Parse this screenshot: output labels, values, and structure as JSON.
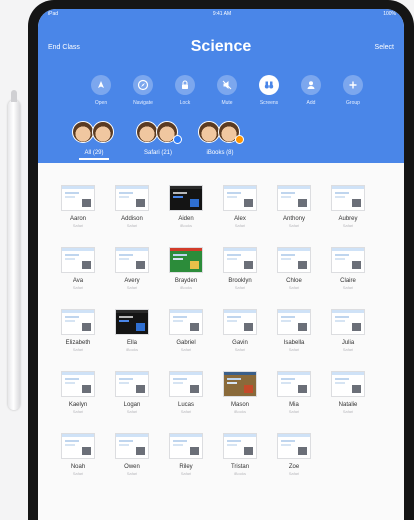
{
  "status_bar": {
    "left": "iPad",
    "time": "9:41 AM",
    "battery": "100%"
  },
  "nav": {
    "left": "End Class",
    "title": "Science",
    "right": "Select"
  },
  "tools": [
    {
      "label": "Open",
      "icon": "open-icon"
    },
    {
      "label": "Navigate",
      "icon": "compass-icon"
    },
    {
      "label": "Lock",
      "icon": "lock-icon"
    },
    {
      "label": "Mute",
      "icon": "mute-icon"
    },
    {
      "label": "Screens",
      "icon": "binoculars-icon"
    },
    {
      "label": "Add",
      "icon": "add-person-icon"
    },
    {
      "label": "Group",
      "icon": "plus-icon"
    }
  ],
  "groups": [
    {
      "label": "All (29)",
      "selected": true
    },
    {
      "label": "Safari (21)",
      "selected": false,
      "badge_color": "#2f7cf6"
    },
    {
      "label": "iBooks (8)",
      "selected": false,
      "badge_color": "#ff9500"
    }
  ],
  "students": [
    {
      "name": "Aaron",
      "sub": "Safari",
      "thumb": "page"
    },
    {
      "name": "Addison",
      "sub": "Safari",
      "thumb": "page"
    },
    {
      "name": "Aiden",
      "sub": "iBooks",
      "thumb": "dark"
    },
    {
      "name": "Alex",
      "sub": "Safari",
      "thumb": "page"
    },
    {
      "name": "Anthony",
      "sub": "Safari",
      "thumb": "page"
    },
    {
      "name": "Aubrey",
      "sub": "Safari",
      "thumb": "page"
    },
    {
      "name": "Ava",
      "sub": "Safari",
      "thumb": "page"
    },
    {
      "name": "Avery",
      "sub": "Safari",
      "thumb": "page"
    },
    {
      "name": "Brayden",
      "sub": "iBooks",
      "thumb": "game"
    },
    {
      "name": "Brooklyn",
      "sub": "Safari",
      "thumb": "page"
    },
    {
      "name": "Chloe",
      "sub": "Safari",
      "thumb": "page"
    },
    {
      "name": "Claire",
      "sub": "Safari",
      "thumb": "page"
    },
    {
      "name": "Elizabeth",
      "sub": "Safari",
      "thumb": "page"
    },
    {
      "name": "Ella",
      "sub": "iBooks",
      "thumb": "dark"
    },
    {
      "name": "Gabriel",
      "sub": "Safari",
      "thumb": "page"
    },
    {
      "name": "Gavin",
      "sub": "Safari",
      "thumb": "page"
    },
    {
      "name": "Isabella",
      "sub": "Safari",
      "thumb": "page"
    },
    {
      "name": "Julia",
      "sub": "Safari",
      "thumb": "page"
    },
    {
      "name": "Kaelyn",
      "sub": "Safari",
      "thumb": "page"
    },
    {
      "name": "Logan",
      "sub": "Safari",
      "thumb": "page"
    },
    {
      "name": "Lucas",
      "sub": "Safari",
      "thumb": "page"
    },
    {
      "name": "Mason",
      "sub": "iBooks",
      "thumb": "photo"
    },
    {
      "name": "Mia",
      "sub": "Safari",
      "thumb": "page"
    },
    {
      "name": "Natalie",
      "sub": "Safari",
      "thumb": "page"
    },
    {
      "name": "Noah",
      "sub": "Safari",
      "thumb": "page"
    },
    {
      "name": "Owen",
      "sub": "Safari",
      "thumb": "page"
    },
    {
      "name": "Riley",
      "sub": "Safari",
      "thumb": "page"
    },
    {
      "name": "Tristan",
      "sub": "iBooks",
      "thumb": "page"
    },
    {
      "name": "Zoe",
      "sub": "Safari",
      "thumb": "page"
    }
  ],
  "colors": {
    "header": "#4a86e8",
    "device": "#151515"
  }
}
